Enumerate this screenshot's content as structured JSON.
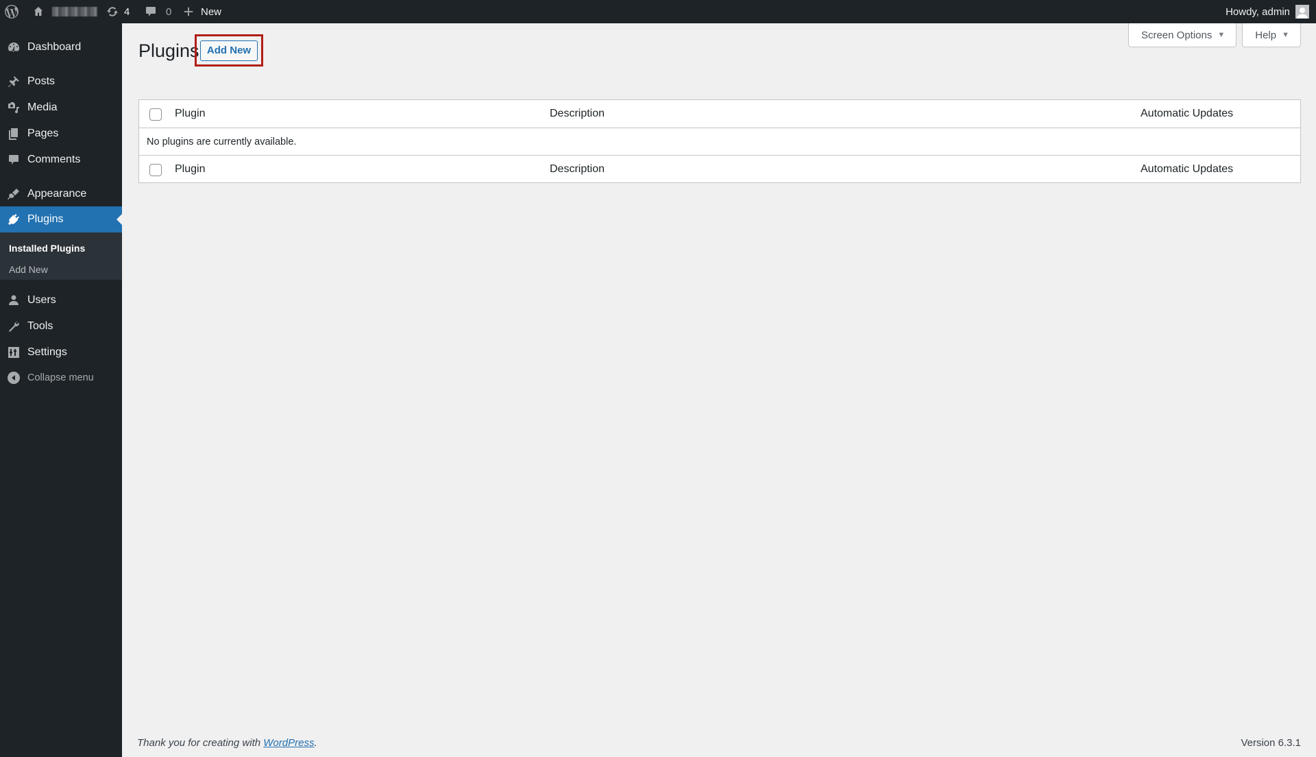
{
  "admin_bar": {
    "site_name_redacted": true,
    "updates_count": "4",
    "comments_count": "0",
    "new_label": "New",
    "howdy": "Howdy, admin",
    "icons": {
      "logo": "wordpress-logo-icon",
      "home": "home-icon",
      "updates": "updates-icon",
      "comments": "comment-icon",
      "new": "plus-icon",
      "avatar": "avatar-icon"
    }
  },
  "sidebar": {
    "items": [
      {
        "label": "Dashboard",
        "icon": "dashboard-icon"
      },
      {
        "label": "Posts",
        "icon": "pushpin-icon"
      },
      {
        "label": "Media",
        "icon": "media-icon"
      },
      {
        "label": "Pages",
        "icon": "pages-icon"
      },
      {
        "label": "Comments",
        "icon": "comment-icon"
      },
      {
        "label": "Appearance",
        "icon": "paintbrush-icon"
      },
      {
        "label": "Plugins",
        "icon": "plugin-icon",
        "current": true
      },
      {
        "label": "Users",
        "icon": "users-icon"
      },
      {
        "label": "Tools",
        "icon": "wrench-icon"
      },
      {
        "label": "Settings",
        "icon": "settings-icon"
      }
    ],
    "submenu": [
      {
        "label": "Installed Plugins",
        "current": true
      },
      {
        "label": "Add New"
      }
    ],
    "collapse_label": "Collapse menu"
  },
  "header": {
    "title": "Plugins",
    "add_new_label": "Add New",
    "screen_options_label": "Screen Options",
    "help_label": "Help"
  },
  "table": {
    "columns": [
      "Plugin",
      "Description",
      "Automatic Updates"
    ],
    "empty_message": "No plugins are currently available."
  },
  "footer": {
    "thanks_prefix": "Thank you for creating with ",
    "thanks_link": "WordPress",
    "thanks_suffix": ".",
    "version": "Version 6.3.1"
  },
  "colors": {
    "accent": "#2271b1",
    "adminbar_bg": "#1d2327",
    "highlight_annotation": "#b01e14"
  }
}
